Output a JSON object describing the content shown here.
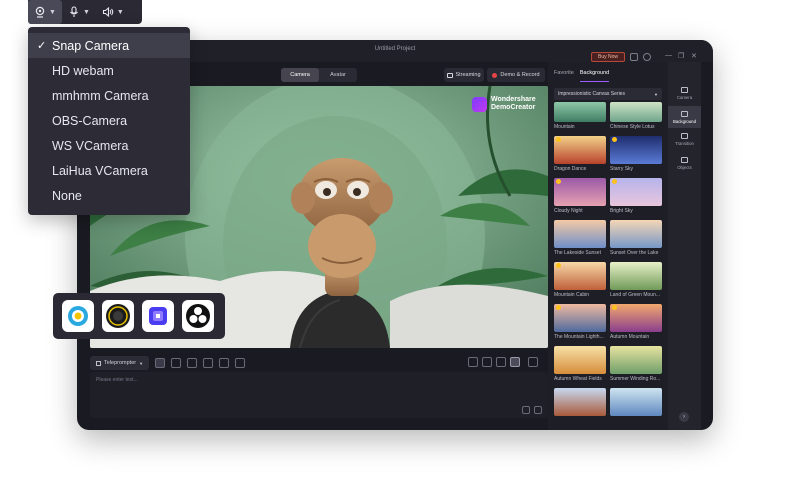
{
  "toolbar": {
    "camera_icon": "webcam-icon",
    "mic_icon": "microphone-icon",
    "speaker_icon": "speaker-icon"
  },
  "camera_menu": {
    "items": [
      "Snap Camera",
      "HD webam",
      "mmhmm Camera",
      "OBS-Camera",
      "WS VCamera",
      "LaiHua VCamera",
      "None"
    ],
    "selected": "Snap Camera"
  },
  "window": {
    "title": "Untitled Project",
    "buy_label": "Buy Now"
  },
  "mode_tabs": [
    "Camera",
    "Avatar"
  ],
  "actions": {
    "streaming": "Streaming",
    "demo_record": "Demo & Record"
  },
  "watermark": {
    "line1": "Wondershare",
    "line2": "DemoCreator"
  },
  "teleprompter": {
    "label": "Teleprompter",
    "placeholder": "Please enter text..."
  },
  "panel": {
    "tabs": [
      "Favorite",
      "Background"
    ],
    "active_tab": "Background",
    "category": "Impressionistic Canvas Series",
    "thumbs": [
      [
        "Mountain",
        "Chinese Style Lotus"
      ],
      [
        "Dragon Dance",
        "Starry Sky"
      ],
      [
        "Cloudy Night",
        "Bright Sky"
      ],
      [
        "The Lakeside Sunset",
        "Sunset Over the Lake"
      ],
      [
        "Mountain Cabin",
        "Land of Green Moun..."
      ],
      [
        "The Mountain Lighth...",
        "Autumn Mountain"
      ],
      [
        "Autumn Wheat Fields",
        "Summer Winding Ro..."
      ],
      [
        "",
        ""
      ]
    ]
  },
  "rail": [
    "Camera",
    "Background",
    "Transition",
    "Objects"
  ],
  "apps": [
    "snap-camera-app-icon",
    "hd-webcam-app-icon",
    "mmhmm-app-icon",
    "obs-camera-app-icon"
  ]
}
